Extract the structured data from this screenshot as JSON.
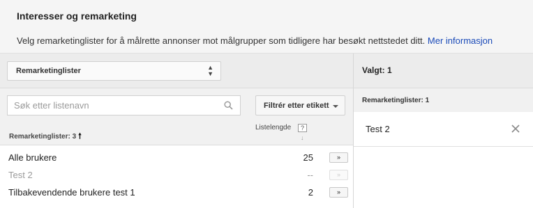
{
  "header": {
    "title": "Interesser og remarketing",
    "description": "Velg remarketinglister for å målrette annonser mot målgrupper som tidligere har besøkt nettstedet ditt.",
    "link_label": "Mer informasjon"
  },
  "left": {
    "list_type_select": {
      "value": "Remarketinglister",
      "icon": "sort-arrows-icon"
    },
    "search": {
      "placeholder": "Søk etter listenavn",
      "value": "",
      "icon": "search-icon"
    },
    "filter_button": {
      "label": "Filtrér etter etikett",
      "icon": "caret-down-icon"
    },
    "table": {
      "name_header": "Remarketinglister: 3",
      "sort_icon": "arrow-up-icon",
      "length_header": "Listelengde",
      "help_label": "?",
      "length_sort_icon": "arrow-down-icon",
      "rows": [
        {
          "name": "Alle brukere",
          "count": "25",
          "add_label": "»",
          "disabled": false
        },
        {
          "name": "Test 2",
          "count": "--",
          "add_label": "»",
          "disabled": true
        },
        {
          "name": "Tilbakevendende brukere test 1",
          "count": "2",
          "add_label": "»",
          "disabled": false
        }
      ]
    }
  },
  "right": {
    "title": "Valgt: 1",
    "subheader": "Remarketinglister: 1",
    "selected": [
      {
        "name": "Test 2",
        "remove_icon": "close-icon"
      }
    ]
  }
}
